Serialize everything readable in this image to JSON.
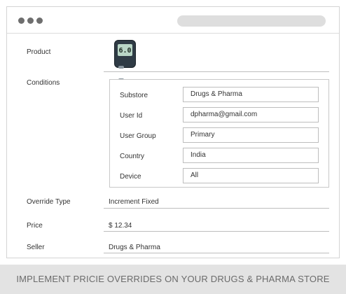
{
  "window": {
    "controls": [
      "close-dot",
      "minimize-dot",
      "maximize-dot"
    ]
  },
  "product": {
    "label": "Product",
    "image_icon": "glucose-meter-icon",
    "device_screen_text": "6.0"
  },
  "conditions": {
    "label": "Conditions",
    "fields": [
      {
        "label": "Substore",
        "value": "Drugs & Pharma"
      },
      {
        "label": "User Id",
        "value": "dpharma@gmail.com"
      },
      {
        "label": "User Group",
        "value": "Primary"
      },
      {
        "label": "Country",
        "value": "India"
      },
      {
        "label": "Device",
        "value": "All"
      }
    ]
  },
  "override_type": {
    "label": "Override Type",
    "value": "Increment Fixed"
  },
  "price": {
    "label": "Price",
    "value": "$ 12.34"
  },
  "seller": {
    "label": "Seller",
    "value": "Drugs & Pharma"
  },
  "banner": {
    "text": "IMPLEMENT PRICIE OVERRIDES ON YOUR DRUGS & PHARMA STORE"
  }
}
